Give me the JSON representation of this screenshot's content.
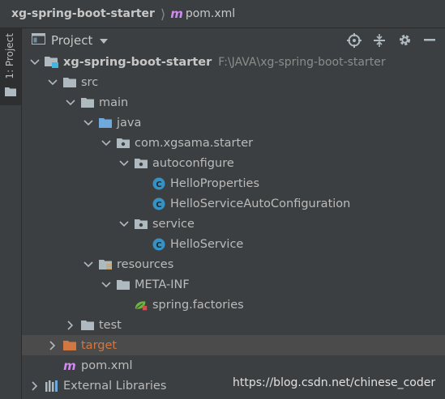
{
  "breadcrumb": {
    "project": "xg-spring-boot-starter",
    "file": "pom.xml",
    "file_icon": "m"
  },
  "tool_strip": {
    "label": "1: Project"
  },
  "panel": {
    "view_label": "Project"
  },
  "tree": [
    {
      "label": "xg-spring-boot-starter",
      "path": "F:\\JAVA\\xg-spring-boot-starter",
      "icon": "module-folder-icon",
      "depth": 0,
      "expanded": true,
      "bold": true
    },
    {
      "label": "src",
      "icon": "folder-icon",
      "depth": 1,
      "expanded": true
    },
    {
      "label": "main",
      "icon": "folder-icon",
      "depth": 2,
      "expanded": true
    },
    {
      "label": "java",
      "icon": "source-root-icon",
      "depth": 3,
      "expanded": true
    },
    {
      "label": "com.xgsama.starter",
      "icon": "package-icon",
      "depth": 4,
      "expanded": true
    },
    {
      "label": "autoconfigure",
      "icon": "package-icon",
      "depth": 5,
      "expanded": true
    },
    {
      "label": "HelloProperties",
      "icon": "class-icon",
      "depth": 6
    },
    {
      "label": "HelloServiceAutoConfiguration",
      "icon": "class-icon",
      "depth": 6
    },
    {
      "label": "service",
      "icon": "package-icon",
      "depth": 5,
      "expanded": true
    },
    {
      "label": "HelloService",
      "icon": "class-icon",
      "depth": 6
    },
    {
      "label": "resources",
      "icon": "resources-root-icon",
      "depth": 3,
      "expanded": true
    },
    {
      "label": "META-INF",
      "icon": "folder-icon",
      "depth": 4,
      "expanded": true
    },
    {
      "label": "spring.factories",
      "icon": "spring-icon",
      "depth": 5
    },
    {
      "label": "test",
      "icon": "folder-icon",
      "depth": 2,
      "expanded": false
    },
    {
      "label": "target",
      "icon": "excluded-folder-icon",
      "depth": 1,
      "expanded": false,
      "selected": true,
      "excluded": true
    },
    {
      "label": "pom.xml",
      "icon": "maven-icon",
      "depth": 1
    },
    {
      "label": "External Libraries",
      "icon": "libraries-icon",
      "depth": 0,
      "expanded": false
    }
  ],
  "watermark": "https://blog.csdn.net/chinese_coder"
}
